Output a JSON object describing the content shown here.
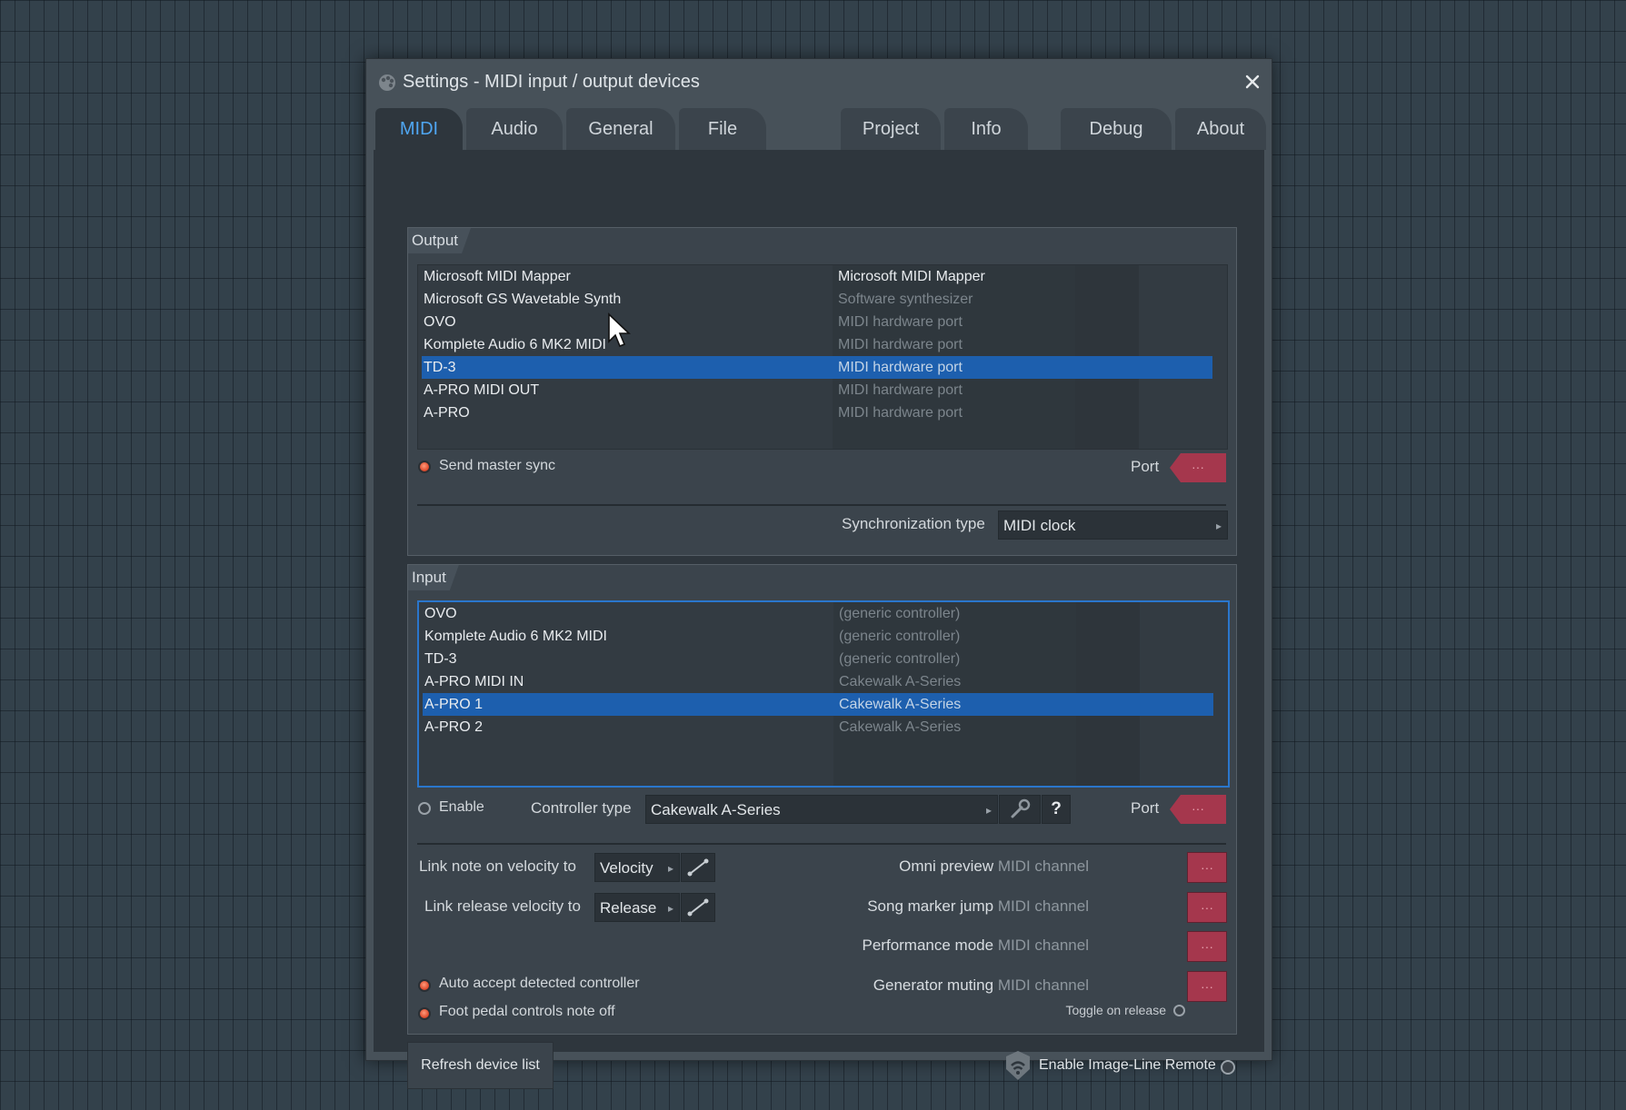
{
  "window": {
    "title": "Settings - MIDI input / output devices"
  },
  "tabs": [
    {
      "label": "MIDI"
    },
    {
      "label": "Audio"
    },
    {
      "label": "General"
    },
    {
      "label": "File"
    },
    {
      "label": "Project"
    },
    {
      "label": "Info"
    },
    {
      "label": "Debug"
    },
    {
      "label": "About"
    }
  ],
  "output": {
    "label": "Output",
    "devices": [
      {
        "name": "Microsoft MIDI Mapper",
        "type": "Microsoft MIDI Mapper"
      },
      {
        "name": "Microsoft GS Wavetable Synth",
        "type": "Software synthesizer"
      },
      {
        "name": "OVO",
        "type": "MIDI hardware port"
      },
      {
        "name": "Komplete Audio 6 MK2 MIDI",
        "type": "MIDI hardware port"
      },
      {
        "name": "TD-3",
        "type": "MIDI hardware port"
      },
      {
        "name": "A-PRO MIDI OUT",
        "type": "MIDI hardware port"
      },
      {
        "name": "A-PRO",
        "type": "MIDI hardware port"
      }
    ],
    "send_master_sync": "Send master sync",
    "port_label": "Port",
    "port_value": "···",
    "sync_type_label": "Synchronization type",
    "sync_type_value": "MIDI clock"
  },
  "input": {
    "label": "Input",
    "devices": [
      {
        "name": "OVO",
        "type": "(generic controller)"
      },
      {
        "name": "Komplete Audio 6 MK2 MIDI",
        "type": "(generic controller)"
      },
      {
        "name": "TD-3",
        "type": "(generic controller)"
      },
      {
        "name": "A-PRO MIDI IN",
        "type": "Cakewalk A-Series"
      },
      {
        "name": "A-PRO 1",
        "type": "Cakewalk A-Series"
      },
      {
        "name": "A-PRO 2",
        "type": "Cakewalk A-Series"
      }
    ],
    "enable_label": "Enable",
    "controller_type_label": "Controller type",
    "controller_type_value": "Cakewalk A-Series",
    "help_label": "?",
    "port_label": "Port",
    "port_value": "···",
    "link_note_on_label": "Link note on velocity to",
    "link_note_on_value": "Velocity",
    "link_release_label": "Link release velocity to",
    "link_release_value": "Release",
    "omni_preview": {
      "label": "Omni preview",
      "sub": "MIDI channel",
      "value": "···"
    },
    "song_marker_jump": {
      "label": "Song marker jump",
      "sub": "MIDI channel",
      "value": "···"
    },
    "performance_mode": {
      "label": "Performance mode",
      "sub": "MIDI channel",
      "value": "···"
    },
    "generator_muting": {
      "label": "Generator muting",
      "sub": "MIDI channel",
      "value": "···"
    },
    "toggle_on_release": "Toggle on release",
    "auto_accept": "Auto accept detected controller",
    "foot_pedal": "Foot pedal controls note off"
  },
  "footer": {
    "refresh_label": "Refresh device list",
    "remote_label": "Enable Image-Line Remote"
  },
  "colors": {
    "accent_tab": "#4fa6f2",
    "selection": "#1d5fae",
    "port_red": "#a5374d",
    "led_on": "#e25032"
  }
}
